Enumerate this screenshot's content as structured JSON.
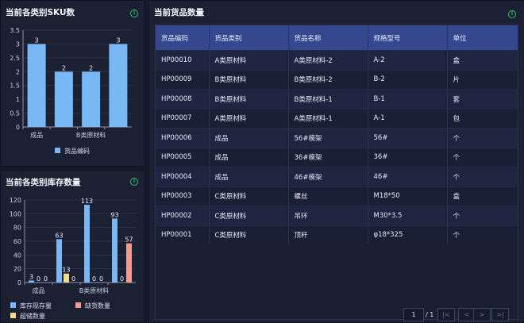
{
  "sku_panel": {
    "title": "当前各类别SKU数",
    "chart_data": {
      "type": "bar",
      "categories": [
        "成品",
        "A类原材料",
        "B类原材料",
        "C类原材料"
      ],
      "x_tick_labels": [
        "成品",
        "",
        "B类原材料",
        ""
      ],
      "series": [
        {
          "name": "货品编码",
          "values": [
            3,
            2,
            2,
            3
          ],
          "color": "#7ab8f5"
        }
      ],
      "ylim": [
        0,
        3.5
      ],
      "yticks": [
        "0",
        "0.5",
        "1",
        "1.5",
        "2",
        "2.5",
        "3",
        "3.5"
      ],
      "legend": "bottom"
    }
  },
  "stock_panel": {
    "title": "当前各类别库存数量",
    "chart_data": {
      "type": "bar",
      "categories": [
        "成品",
        "A类原材料",
        "B类原材料",
        "C类原材料"
      ],
      "x_tick_labels": [
        "成品",
        "",
        "B类原材料",
        ""
      ],
      "series": [
        {
          "name": "库存现存量",
          "values": [
            3,
            63,
            113,
            93
          ],
          "color": "#7ab8f5"
        },
        {
          "name": "超储数量",
          "values": [
            0,
            13,
            0,
            0
          ],
          "color": "#f2dc8a"
        },
        {
          "name": "缺货数量",
          "values": [
            0,
            0,
            0,
            57
          ],
          "color": "#f29b8e"
        }
      ],
      "ylim": [
        0,
        120
      ],
      "yticks": [
        "0",
        "20",
        "40",
        "60",
        "80",
        "100",
        "120"
      ],
      "legend": "bottom"
    }
  },
  "goods_panel": {
    "title": "当前货品数量",
    "columns": [
      "货品编码",
      "货品类别",
      "货品名称",
      "规格型号",
      "单位"
    ],
    "rows": [
      [
        "HP00010",
        "A类原材料",
        "A类原材料-2",
        "A-2",
        "盒"
      ],
      [
        "HP00009",
        "B类原材料",
        "B类原材料-2",
        "B-2",
        "片"
      ],
      [
        "HP00008",
        "B类原材料",
        "B类原材料-1",
        "B-1",
        "套"
      ],
      [
        "HP00007",
        "A类原材料",
        "A类原材料-1",
        "A-1",
        "包"
      ],
      [
        "HP00006",
        "成品",
        "56#模架",
        "56#",
        "个"
      ],
      [
        "HP00005",
        "成品",
        "36#模架",
        "36#",
        "个"
      ],
      [
        "HP00004",
        "成品",
        "46#模架",
        "46#",
        "个"
      ],
      [
        "HP00003",
        "C类原材料",
        "螺丝",
        "M18*50",
        "盒"
      ],
      [
        "HP00002",
        "C类原材料",
        "吊环",
        "M30*3.5",
        "个"
      ],
      [
        "HP00001",
        "C类原材料",
        "顶杆",
        "φ18*325",
        "个"
      ]
    ],
    "pager": {
      "current": "1",
      "total": "/ 1",
      "first": "|<",
      "prev": "<",
      "next": ">",
      "last": ">|"
    }
  },
  "icons": {
    "info": "info-circle-icon",
    "info_glyph": "i",
    "info_color": "#34c46a"
  }
}
